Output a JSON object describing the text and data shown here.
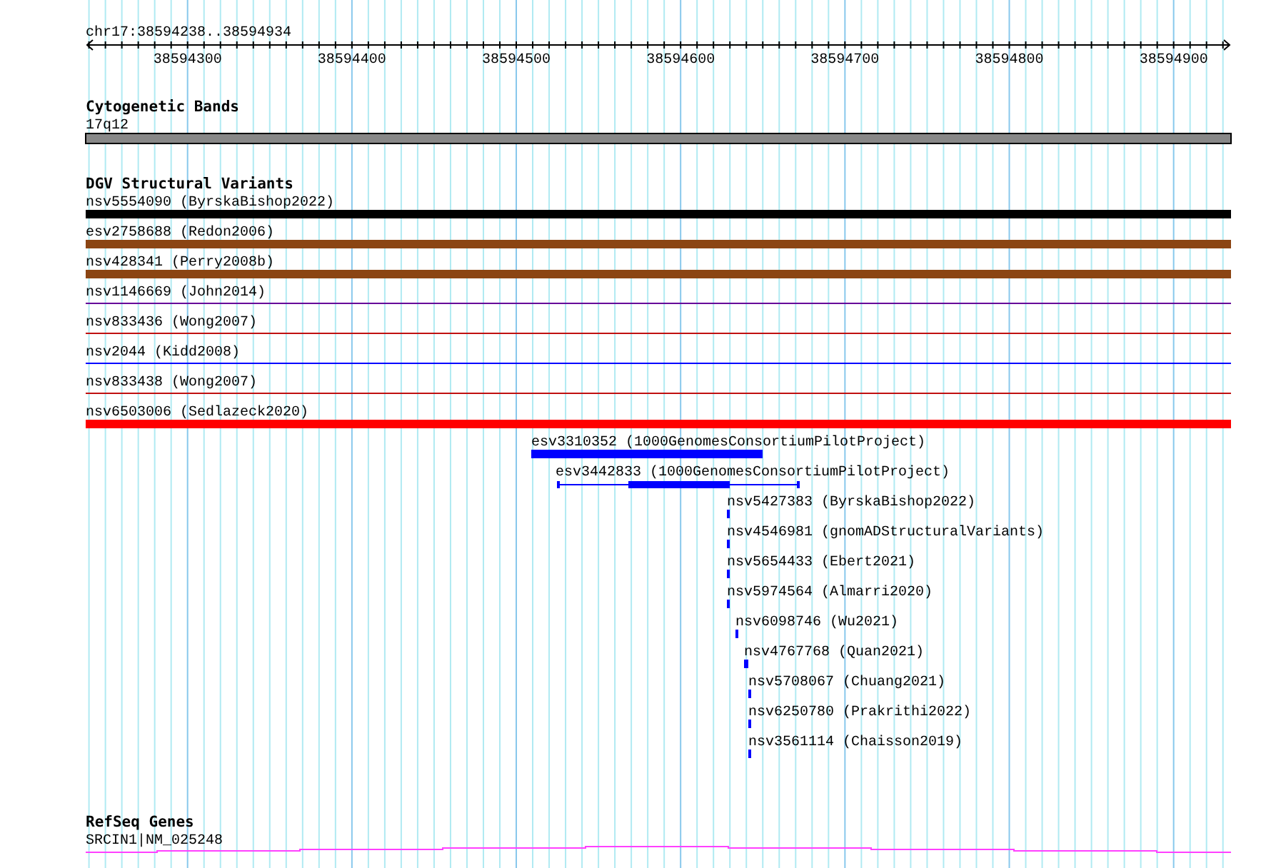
{
  "ruler": {
    "title": "chr17:38594238..38594934",
    "ticks": [
      "38594300",
      "38594400",
      "38594500",
      "38594600",
      "38594700",
      "38594800",
      "38594900"
    ]
  },
  "tracks": [
    {
      "title": "Cytogenetic Bands",
      "features": [
        {
          "label": "17q12",
          "kind": "band",
          "color": "#888888"
        }
      ]
    },
    {
      "title": "DGV Structural Variants",
      "features": [
        {
          "label": "nsv5554090 (ByrskaBishop2022)",
          "kind": "thick",
          "color": "#000000"
        },
        {
          "label": "esv2758688 (Redon2006)",
          "kind": "thick",
          "color": "#8b4513"
        },
        {
          "label": "nsv428341 (Perry2008b)",
          "kind": "thick",
          "color": "#8b4513"
        },
        {
          "label": "nsv1146669 (John2014)",
          "kind": "thin",
          "color": "#660099"
        },
        {
          "label": "nsv833436 (Wong2007)",
          "kind": "thin",
          "color": "#c01010"
        },
        {
          "label": "nsv2044 (Kidd2008)",
          "kind": "thin",
          "color": "#0000ff"
        },
        {
          "label": "nsv833438 (Wong2007)",
          "kind": "thin",
          "color": "#c01010"
        },
        {
          "label": "nsv6503006 (Sedlazeck2020)",
          "kind": "thick",
          "color": "#ff0000"
        },
        {
          "label": "esv3310352 (1000GenomesConsortiumPilotProject)",
          "kind": "thick",
          "color": "#0000ff"
        },
        {
          "label": "esv3442833 (1000GenomesConsortiumPilotProject)",
          "kind": "gapped",
          "color": "#0000ff"
        },
        {
          "label": "nsv5427383 (ByrskaBishop2022)",
          "kind": "thick",
          "color": "#0000ff"
        },
        {
          "label": "nsv4546981 (gnomADStructuralVariants)",
          "kind": "thick",
          "color": "#0000ff"
        },
        {
          "label": "nsv5654433 (Ebert2021)",
          "kind": "thick",
          "color": "#0000ff"
        },
        {
          "label": "nsv5974564 (Almarri2020)",
          "kind": "thick",
          "color": "#0000ff"
        },
        {
          "label": "nsv6098746 (Wu2021)",
          "kind": "thick",
          "color": "#0000ff"
        },
        {
          "label": "nsv4767768 (Quan2021)",
          "kind": "thick",
          "color": "#0000ff"
        },
        {
          "label": "nsv5708067 (Chuang2021)",
          "kind": "thick",
          "color": "#0000ff"
        },
        {
          "label": "nsv6250780 (Prakrithi2022)",
          "kind": "thick",
          "color": "#0000ff"
        },
        {
          "label": "nsv3561114 (Chaisson2019)",
          "kind": "thick",
          "color": "#0000ff"
        }
      ]
    },
    {
      "title": "RefSeq Genes",
      "features": [
        {
          "label": "SRCIN1|NM_025248",
          "kind": "gene",
          "color": "#ff40ff"
        }
      ]
    }
  ]
}
